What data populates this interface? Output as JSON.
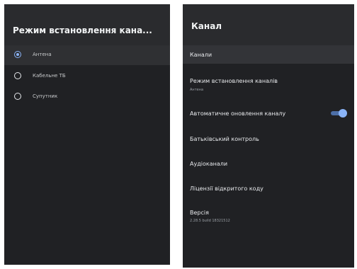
{
  "input_mode_panel": {
    "title": "Режим встановлення кана...",
    "options": [
      {
        "label": "Антена",
        "selected": true
      },
      {
        "label": "Кабельне ТБ",
        "selected": false
      },
      {
        "label": "Супутник",
        "selected": false
      }
    ]
  },
  "channel_panel": {
    "title": "Канал",
    "items": [
      {
        "label": "Канали"
      },
      {
        "label": "Режим встановлення каналів",
        "sub": "Антена"
      },
      {
        "label": "Автоматичне оновлення каналу",
        "toggle": "on"
      },
      {
        "label": "Батьківський контроль"
      },
      {
        "label": "Аудіоканали"
      },
      {
        "label": "Ліцензії відкритого коду"
      },
      {
        "label": "Версія",
        "sub": "2.28.5 build 18321512"
      }
    ]
  },
  "colors": {
    "background": "#202124",
    "accent": "#8ab4f8"
  }
}
